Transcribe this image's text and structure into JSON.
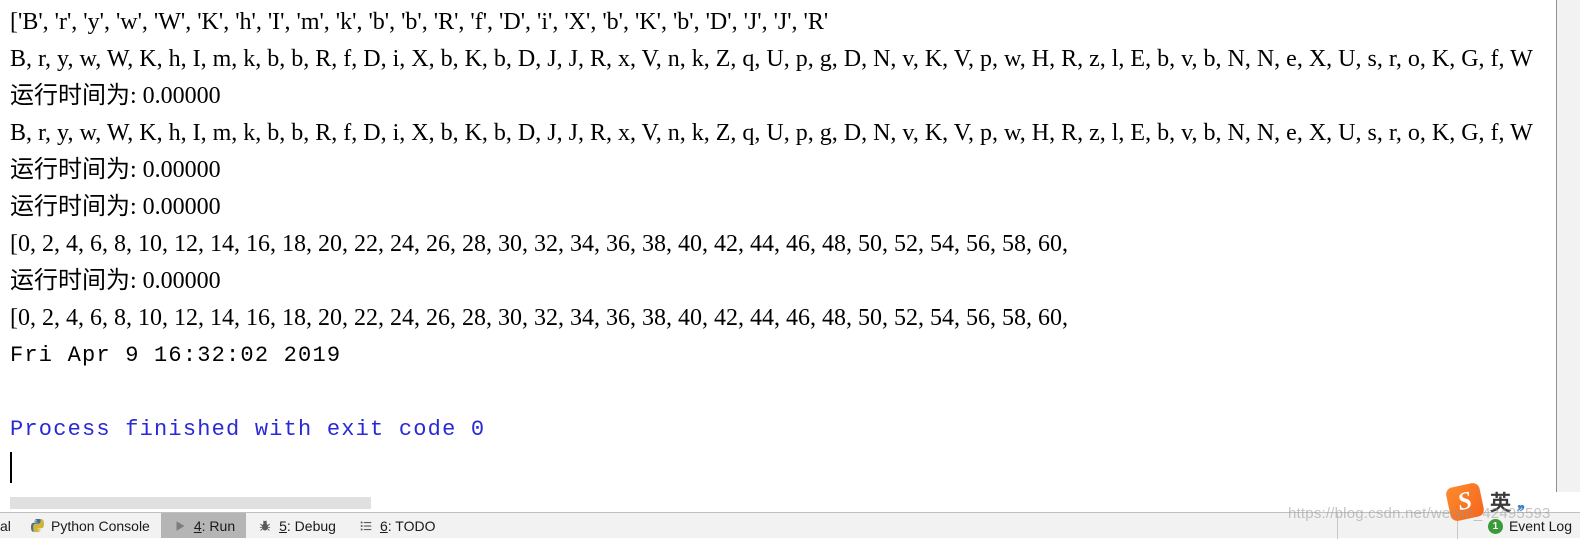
{
  "console": {
    "lines": [
      {
        "id": "line-char-list",
        "kind": "output",
        "text": "['B', 'r', 'y', 'w', 'W', 'K', 'h', 'I', 'm', 'k', 'b', 'b', 'R', 'f', 'D', 'i', 'X', 'b', 'K', 'b', 'D', 'J', 'J', 'R'"
      },
      {
        "id": "line-char-seq-1",
        "kind": "output",
        "text": "B, r, y, w, W, K, h, I, m, k, b, b, R, f, D, i, X, b, K, b, D, J, J, R, x, V, n, k, Z, q, U, p, g, D, N, v, K, V, p, w, H, R, z, l, E, b, v, b, N, N, e, X, U, s, r, o, K, G, f, W"
      },
      {
        "id": "line-runtime-1",
        "kind": "output",
        "text": "运行时间为: 0.00000"
      },
      {
        "id": "line-char-seq-2",
        "kind": "output",
        "text": "B, r, y, w, W, K, h, I, m, k, b, b, R, f, D, i, X, b, K, b, D, J, J, R, x, V, n, k, Z, q, U, p, g, D, N, v, K, V, p, w, H, R, z, l, E, b, v, b, N, N, e, X, U, s, r, o, K, G, f, W"
      },
      {
        "id": "line-runtime-2",
        "kind": "output",
        "text": "运行时间为: 0.00000"
      },
      {
        "id": "line-runtime-3",
        "kind": "output",
        "text": "运行时间为: 0.00000"
      },
      {
        "id": "line-even-list-1",
        "kind": "output",
        "text": "[0, 2, 4, 6, 8, 10, 12, 14, 16, 18, 20, 22, 24, 26, 28, 30, 32, 34, 36, 38, 40, 42, 44, 46, 48, 50, 52, 54, 56, 58, 60,"
      },
      {
        "id": "line-runtime-4",
        "kind": "output",
        "text": "运行时间为: 0.00000"
      },
      {
        "id": "line-even-list-2",
        "kind": "output",
        "text": "[0, 2, 4, 6, 8, 10, 12, 14, 16, 18, 20, 22, 24, 26, 28, 30, 32, 34, 36, 38, 40, 42, 44, 46, 48, 50, 52, 54, 56, 58, 60,"
      },
      {
        "id": "line-timestamp",
        "kind": "date",
        "text": "Fri Apr 9 16:32:02 2019"
      },
      {
        "id": "line-blank",
        "kind": "blank",
        "text": ""
      },
      {
        "id": "line-exit",
        "kind": "exit",
        "text": "Process finished with exit code 0"
      }
    ],
    "text_color": "#000000",
    "exit_color": "#2929d6",
    "background": "#ffffff"
  },
  "bottom_bar": {
    "tabs": [
      {
        "id": "tab-terminal",
        "icon": "terminal-icon",
        "label_prefix": "",
        "mnemonic": "",
        "label": "al",
        "active": false,
        "clipped": true
      },
      {
        "id": "tab-python-console",
        "icon": "python-icon",
        "label_prefix": "",
        "mnemonic": "",
        "label": "Python Console",
        "active": false,
        "clipped": false
      },
      {
        "id": "tab-run",
        "icon": "run-play-icon",
        "label_prefix": "",
        "mnemonic": "4",
        "label": ": Run",
        "active": true,
        "clipped": false
      },
      {
        "id": "tab-debug",
        "icon": "bug-icon",
        "label_prefix": "",
        "mnemonic": "5",
        "label": ": Debug",
        "active": false,
        "clipped": false
      },
      {
        "id": "tab-todo",
        "icon": "list-icon",
        "label_prefix": "",
        "mnemonic": "6",
        "label": ": TODO",
        "active": false,
        "clipped": false
      }
    ],
    "event_log": {
      "label": "Event Log",
      "badge_count": "1",
      "badge_color": "#389b38"
    }
  },
  "ime": {
    "logo_letter": "S",
    "mode_label": "英",
    "dots": ",,"
  },
  "watermark": {
    "text": "https://blog.csdn.net/weixin_42495593"
  }
}
